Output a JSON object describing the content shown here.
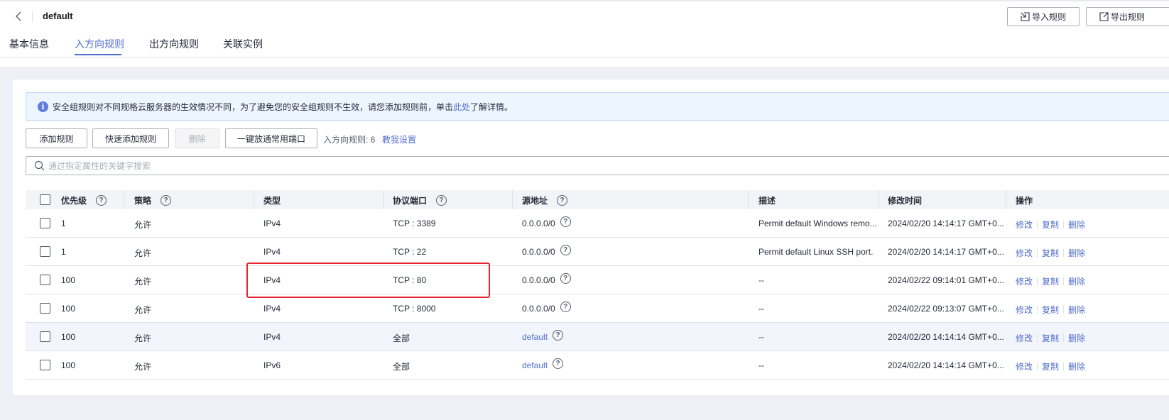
{
  "header": {
    "title": "default",
    "import_label": "导入规则",
    "export_label": "导出规则"
  },
  "tabs": [
    {
      "label": "基本信息"
    },
    {
      "label": "入方向规则"
    },
    {
      "label": "出方向规则"
    },
    {
      "label": "关联实例"
    }
  ],
  "info": {
    "text_before": "安全组规则对不同规格云服务器的生效情况不同，为了避免您的安全组规则不生效，请您添加规则前，单击",
    "link": "此处",
    "text_after": "了解详情。"
  },
  "toolbar": {
    "add_label": "添加规则",
    "quick_add_label": "快速添加规则",
    "delete_label": "删除",
    "open_ports_label": "一键放通常用端口",
    "rule_count": "入方向规则: 6",
    "help_link": "教我设置"
  },
  "search": {
    "placeholder": "通过指定属性的关键字搜索"
  },
  "table": {
    "headers": {
      "priority": "优先级",
      "policy": "策略",
      "type": "类型",
      "protocol_port": "协议端口",
      "source": "源地址",
      "description": "描述",
      "modified": "修改时间",
      "actions": "操作"
    },
    "rows": [
      {
        "priority": "1",
        "policy": "允许",
        "type": "IPv4",
        "port": "TCP : 3389",
        "source": "0.0.0.0/0",
        "description": "Permit default Windows remo...",
        "modified": "2024/02/20 14:14:17 GMT+0...",
        "edit": "修改",
        "copy": "复制",
        "delete": "删除"
      },
      {
        "priority": "1",
        "policy": "允许",
        "type": "IPv4",
        "port": "TCP : 22",
        "source": "0.0.0.0/0",
        "description": "Permit default Linux SSH port.",
        "modified": "2024/02/20 14:14:17 GMT+0...",
        "edit": "修改",
        "copy": "复制",
        "delete": "删除"
      },
      {
        "priority": "100",
        "policy": "允许",
        "type": "IPv4",
        "port": "TCP : 80",
        "source": "0.0.0.0/0",
        "description": "--",
        "modified": "2024/02/22 09:14:01 GMT+0...",
        "edit": "修改",
        "copy": "复制",
        "delete": "删除"
      },
      {
        "priority": "100",
        "policy": "允许",
        "type": "IPv4",
        "port": "TCP : 8000",
        "source": "0.0.0.0/0",
        "description": "--",
        "modified": "2024/02/22 09:13:07 GMT+0...",
        "edit": "修改",
        "copy": "复制",
        "delete": "删除"
      },
      {
        "priority": "100",
        "policy": "允许",
        "type": "IPv4",
        "port": "全部",
        "source": "default",
        "description": "--",
        "modified": "2024/02/20 14:14:14 GMT+0...",
        "edit": "修改",
        "copy": "复制",
        "delete": "删除"
      },
      {
        "priority": "100",
        "policy": "允许",
        "type": "IPv6",
        "port": "全部",
        "source": "default",
        "description": "--",
        "modified": "2024/02/20 14:14:14 GMT+0...",
        "edit": "修改",
        "copy": "复制",
        "delete": "删除"
      }
    ]
  },
  "colors": {
    "accent": "#526ecc",
    "highlight_box": "#e6262e",
    "info_bg": "#edf5ff"
  }
}
